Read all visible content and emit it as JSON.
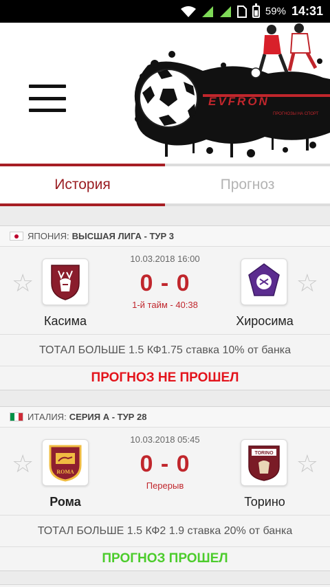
{
  "status_bar": {
    "battery": "59%",
    "time": "14:31"
  },
  "header": {
    "logo_text": "EVFRON",
    "logo_tagline": "ПРОГНОЗЫ НА СПОРТ"
  },
  "tabs": [
    {
      "label": "История"
    },
    {
      "label": "Прогноз"
    }
  ],
  "matches": [
    {
      "country": "ЯПОНИЯ:",
      "competition": "ВЫСШАЯ ЛИГА - ТУР 3",
      "datetime": "10.03.2018 16:00",
      "score": "0 - 0",
      "status": "1-й тайм - 40:38",
      "home_team": "Касима",
      "away_team": "Хиросима",
      "tip": "ТОТАЛ БОЛЬШЕ 1.5 КФ1.75 ставка 10% от банка",
      "result": "ПРОГНОЗ НЕ ПРОШЕЛ"
    },
    {
      "country": "ИТАЛИЯ:",
      "competition": "СЕРИЯ А - ТУР 28",
      "datetime": "10.03.2018 05:45",
      "score": "0 - 0",
      "status": "Перерыв",
      "home_team": "Рома",
      "away_team": "Торино",
      "home_logo_text": "ROMA",
      "away_logo_text": "TORINO",
      "tip": "ТОТАЛ БОЛЬШЕ 1.5 КФ2 1.9 ставка 20% от банка",
      "result": "ПРОГНОЗ ПРОШЕЛ"
    }
  ],
  "colors": {
    "accent": "#a61e24",
    "score": "#c0262c",
    "result_fail": "#e3141c",
    "result_pass": "#4ccc2c"
  }
}
